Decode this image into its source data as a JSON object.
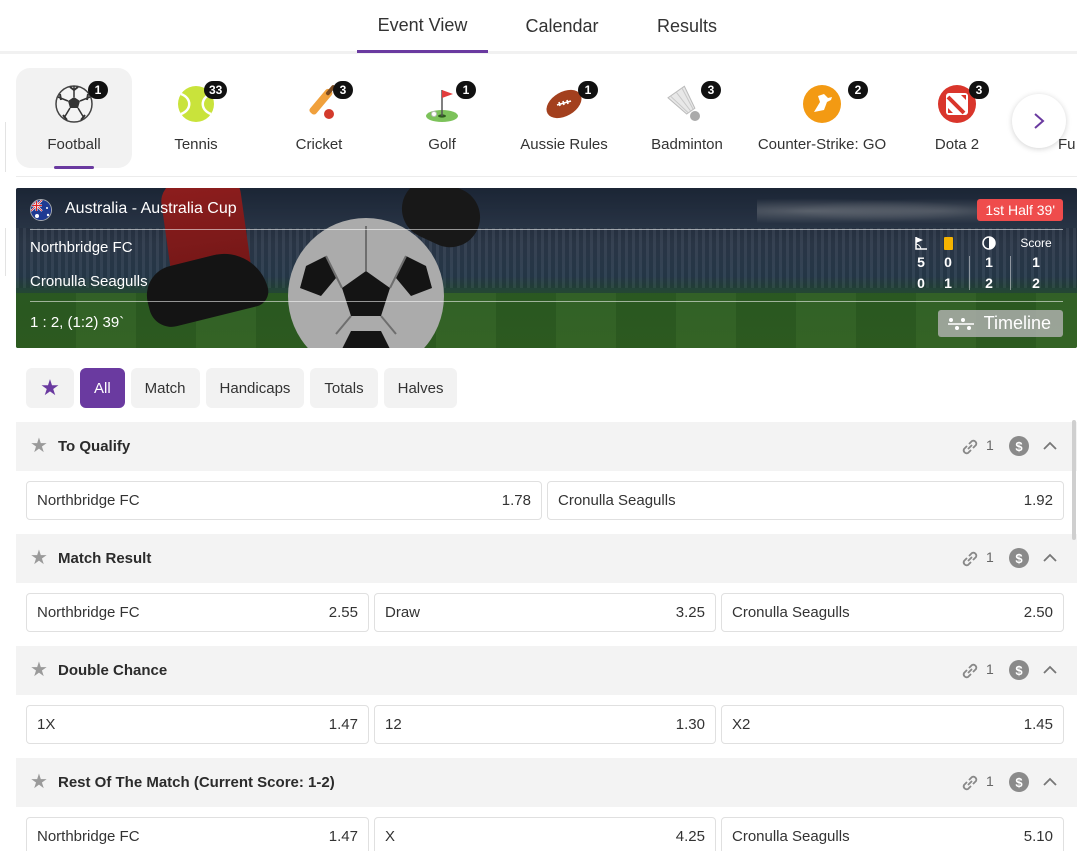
{
  "top_tabs": [
    {
      "label": "Event View",
      "active": true
    },
    {
      "label": "Calendar",
      "active": false
    },
    {
      "label": "Results",
      "active": false
    }
  ],
  "sports": [
    {
      "label": "Football",
      "count": "1",
      "icon": "football-icon",
      "active": true
    },
    {
      "label": "Tennis",
      "count": "33",
      "icon": "tennis-ball-icon",
      "active": false
    },
    {
      "label": "Cricket",
      "count": "3",
      "icon": "cricket-bat-icon",
      "active": false
    },
    {
      "label": "Golf",
      "count": "1",
      "icon": "golf-flag-icon",
      "active": false
    },
    {
      "label": "Aussie Rules",
      "count": "1",
      "icon": "aussie-rules-ball-icon",
      "active": false
    },
    {
      "label": "Badminton",
      "count": "3",
      "icon": "shuttlecock-icon",
      "active": false
    },
    {
      "label": "Counter-Strike: GO",
      "count": "2",
      "icon": "counter-strike-icon",
      "active": false
    },
    {
      "label": "Dota 2",
      "count": "3",
      "icon": "dota2-icon",
      "active": false
    },
    {
      "label": "Fu",
      "count": "",
      "icon": "futsal-icon",
      "active": false
    }
  ],
  "event": {
    "league": "Australia - Australia Cup",
    "status": "1st Half 39'",
    "home": "Northbridge FC",
    "away": "Cronulla Seagulls",
    "score_text": "1 : 2, (1:2) 39`",
    "stats_header_score": "Score",
    "stats": {
      "corners": [
        "5",
        "0"
      ],
      "yellow_cards": [
        "0",
        "1"
      ],
      "halftime": [
        "1",
        "2"
      ],
      "score": [
        "1",
        "2"
      ]
    },
    "timeline_label": "Timeline"
  },
  "filters": [
    {
      "label": "All",
      "active": true
    },
    {
      "label": "Match",
      "active": false
    },
    {
      "label": "Handicaps",
      "active": false
    },
    {
      "label": "Totals",
      "active": false
    },
    {
      "label": "Halves",
      "active": false
    }
  ],
  "markets": [
    {
      "title": "To Qualify",
      "links": "1",
      "odds": [
        {
          "label": "Northbridge FC",
          "price": "1.78"
        },
        {
          "label": "Cronulla Seagulls",
          "price": "1.92"
        }
      ]
    },
    {
      "title": "Match Result",
      "links": "1",
      "odds": [
        {
          "label": "Northbridge FC",
          "price": "2.55"
        },
        {
          "label": "Draw",
          "price": "3.25"
        },
        {
          "label": "Cronulla Seagulls",
          "price": "2.50"
        }
      ]
    },
    {
      "title": "Double Chance",
      "links": "1",
      "odds": [
        {
          "label": "1X",
          "price": "1.47"
        },
        {
          "label": "12",
          "price": "1.30"
        },
        {
          "label": "X2",
          "price": "1.45"
        }
      ]
    },
    {
      "title": "Rest Of The Match (Current Score: 1-2)",
      "links": "1",
      "odds": [
        {
          "label": "Northbridge FC",
          "price": "1.47"
        },
        {
          "label": "X",
          "price": "4.25"
        },
        {
          "label": "Cronulla Seagulls",
          "price": "5.10"
        }
      ]
    }
  ],
  "colors": {
    "accent": "#6a3aa0",
    "live_status": "#ef4c4c",
    "badge": "#111111"
  }
}
